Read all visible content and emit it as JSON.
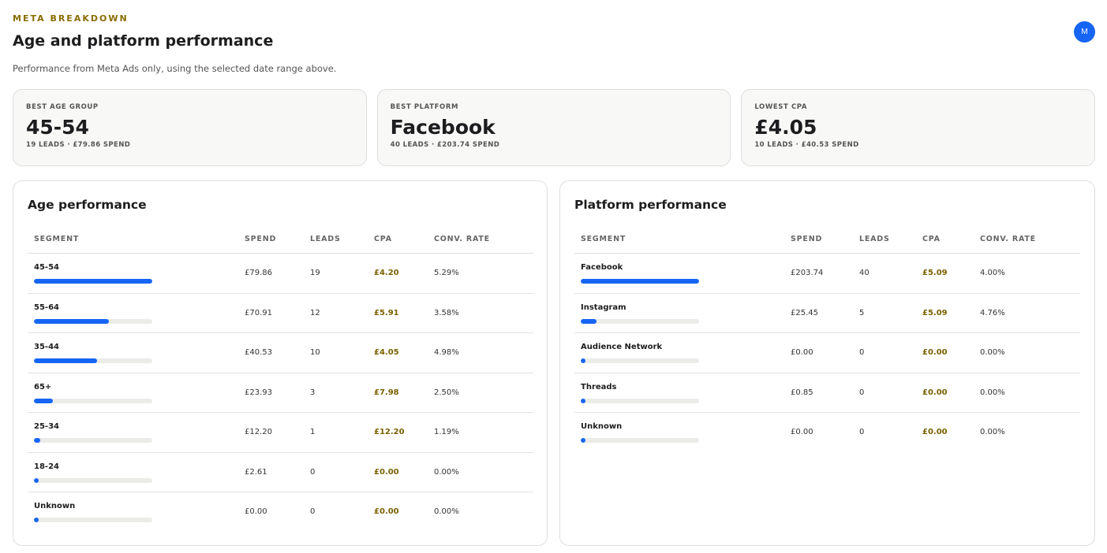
{
  "header": {
    "eyebrow": "META BREAKDOWN",
    "title": "Age and platform performance",
    "subtitle": "Performance from Meta Ads only, using the selected date range above.",
    "avatar_initial": "M"
  },
  "stats": [
    {
      "label": "BEST AGE GROUP",
      "value": "45-54",
      "meta": "19 LEADS · £79.86 SPEND"
    },
    {
      "label": "BEST PLATFORM",
      "value": "Facebook",
      "meta": "40 LEADS · £203.74 SPEND"
    },
    {
      "label": "LOWEST CPA",
      "value": "£4.05",
      "meta": "10 LEADS · £40.53 SPEND"
    }
  ],
  "age_panel": {
    "title": "Age performance",
    "columns": [
      "SEGMENT",
      "SPEND",
      "LEADS",
      "CPA",
      "CONV. RATE"
    ],
    "rows": [
      {
        "segment": "45-54",
        "share": 1.0,
        "spend": "£79.86",
        "leads": "19",
        "cpa": "£4.20",
        "conv": "5.29%"
      },
      {
        "segment": "55-64",
        "share": 0.63,
        "spend": "£70.91",
        "leads": "12",
        "cpa": "£5.91",
        "conv": "3.58%"
      },
      {
        "segment": "35-44",
        "share": 0.53,
        "spend": "£40.53",
        "leads": "10",
        "cpa": "£4.05",
        "conv": "4.98%"
      },
      {
        "segment": "65+",
        "share": 0.16,
        "spend": "£23.93",
        "leads": "3",
        "cpa": "£7.98",
        "conv": "2.50%"
      },
      {
        "segment": "25-34",
        "share": 0.05,
        "spend": "£12.20",
        "leads": "1",
        "cpa": "£12.20",
        "conv": "1.19%"
      },
      {
        "segment": "18-24",
        "share": 0.0,
        "spend": "£2.61",
        "leads": "0",
        "cpa": "£0.00",
        "conv": "0.00%"
      },
      {
        "segment": "Unknown",
        "share": 0.0,
        "spend": "£0.00",
        "leads": "0",
        "cpa": "£0.00",
        "conv": "0.00%"
      }
    ]
  },
  "platform_panel": {
    "title": "Platform performance",
    "columns": [
      "SEGMENT",
      "SPEND",
      "LEADS",
      "CPA",
      "CONV. RATE"
    ],
    "rows": [
      {
        "segment": "Facebook",
        "share": 1.0,
        "spend": "£203.74",
        "leads": "40",
        "cpa": "£5.09",
        "conv": "4.00%"
      },
      {
        "segment": "Instagram",
        "share": 0.13,
        "spend": "£25.45",
        "leads": "5",
        "cpa": "£5.09",
        "conv": "4.76%"
      },
      {
        "segment": "Audience Network",
        "share": 0.0,
        "spend": "£0.00",
        "leads": "0",
        "cpa": "£0.00",
        "conv": "0.00%"
      },
      {
        "segment": "Threads",
        "share": 0.0,
        "spend": "£0.85",
        "leads": "0",
        "cpa": "£0.00",
        "conv": "0.00%"
      },
      {
        "segment": "Unknown",
        "share": 0.0,
        "spend": "£0.00",
        "leads": "0",
        "cpa": "£0.00",
        "conv": "0.00%"
      }
    ]
  },
  "colors": {
    "accent_blue": "#1665f5",
    "eyebrow_gold": "#8a6d00",
    "cpa_gold": "#7a6100"
  }
}
